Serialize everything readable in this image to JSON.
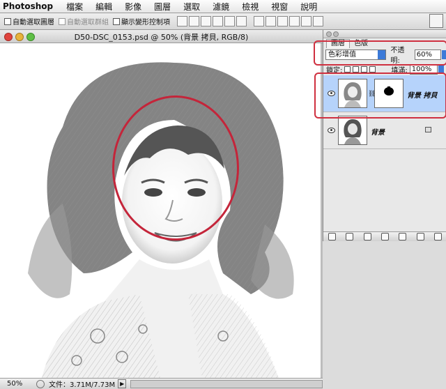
{
  "menubar": {
    "app": "Photoshop",
    "items": [
      "檔案",
      "編輯",
      "影像",
      "圖層",
      "選取",
      "濾鏡",
      "檢視",
      "視窗",
      "說明"
    ]
  },
  "options": {
    "auto_select_layer": "自動選取圖層",
    "auto_select_group": "自動選取群組",
    "show_transform": "顯示變形控制項"
  },
  "document": {
    "title": "D50-DSC_0153.psd @ 50% (背景 拷貝, RGB/8)",
    "zoom": "50%",
    "file_info": "文件：3.71M/7.73M",
    "status_arrow": "▶",
    "canvas_desc": "sketch-style portrait"
  },
  "layers_panel": {
    "tabs": [
      "圖層",
      "色版"
    ],
    "blend_mode": "色彩增值",
    "opacity_label": "不透明:",
    "opacity_value": "60%",
    "lock_label": "鎖定:",
    "fill_label": "填滿:",
    "fill_value": "100%",
    "layers": [
      {
        "name": "背景 拷貝",
        "selected": true,
        "has_mask": true
      },
      {
        "name": "背景",
        "selected": false,
        "locked": true
      }
    ]
  },
  "colors": {
    "highlight_red": "#cf2f3f",
    "selection_blue": "#b6d3fb",
    "accent_blue": "#3c7ad8"
  }
}
